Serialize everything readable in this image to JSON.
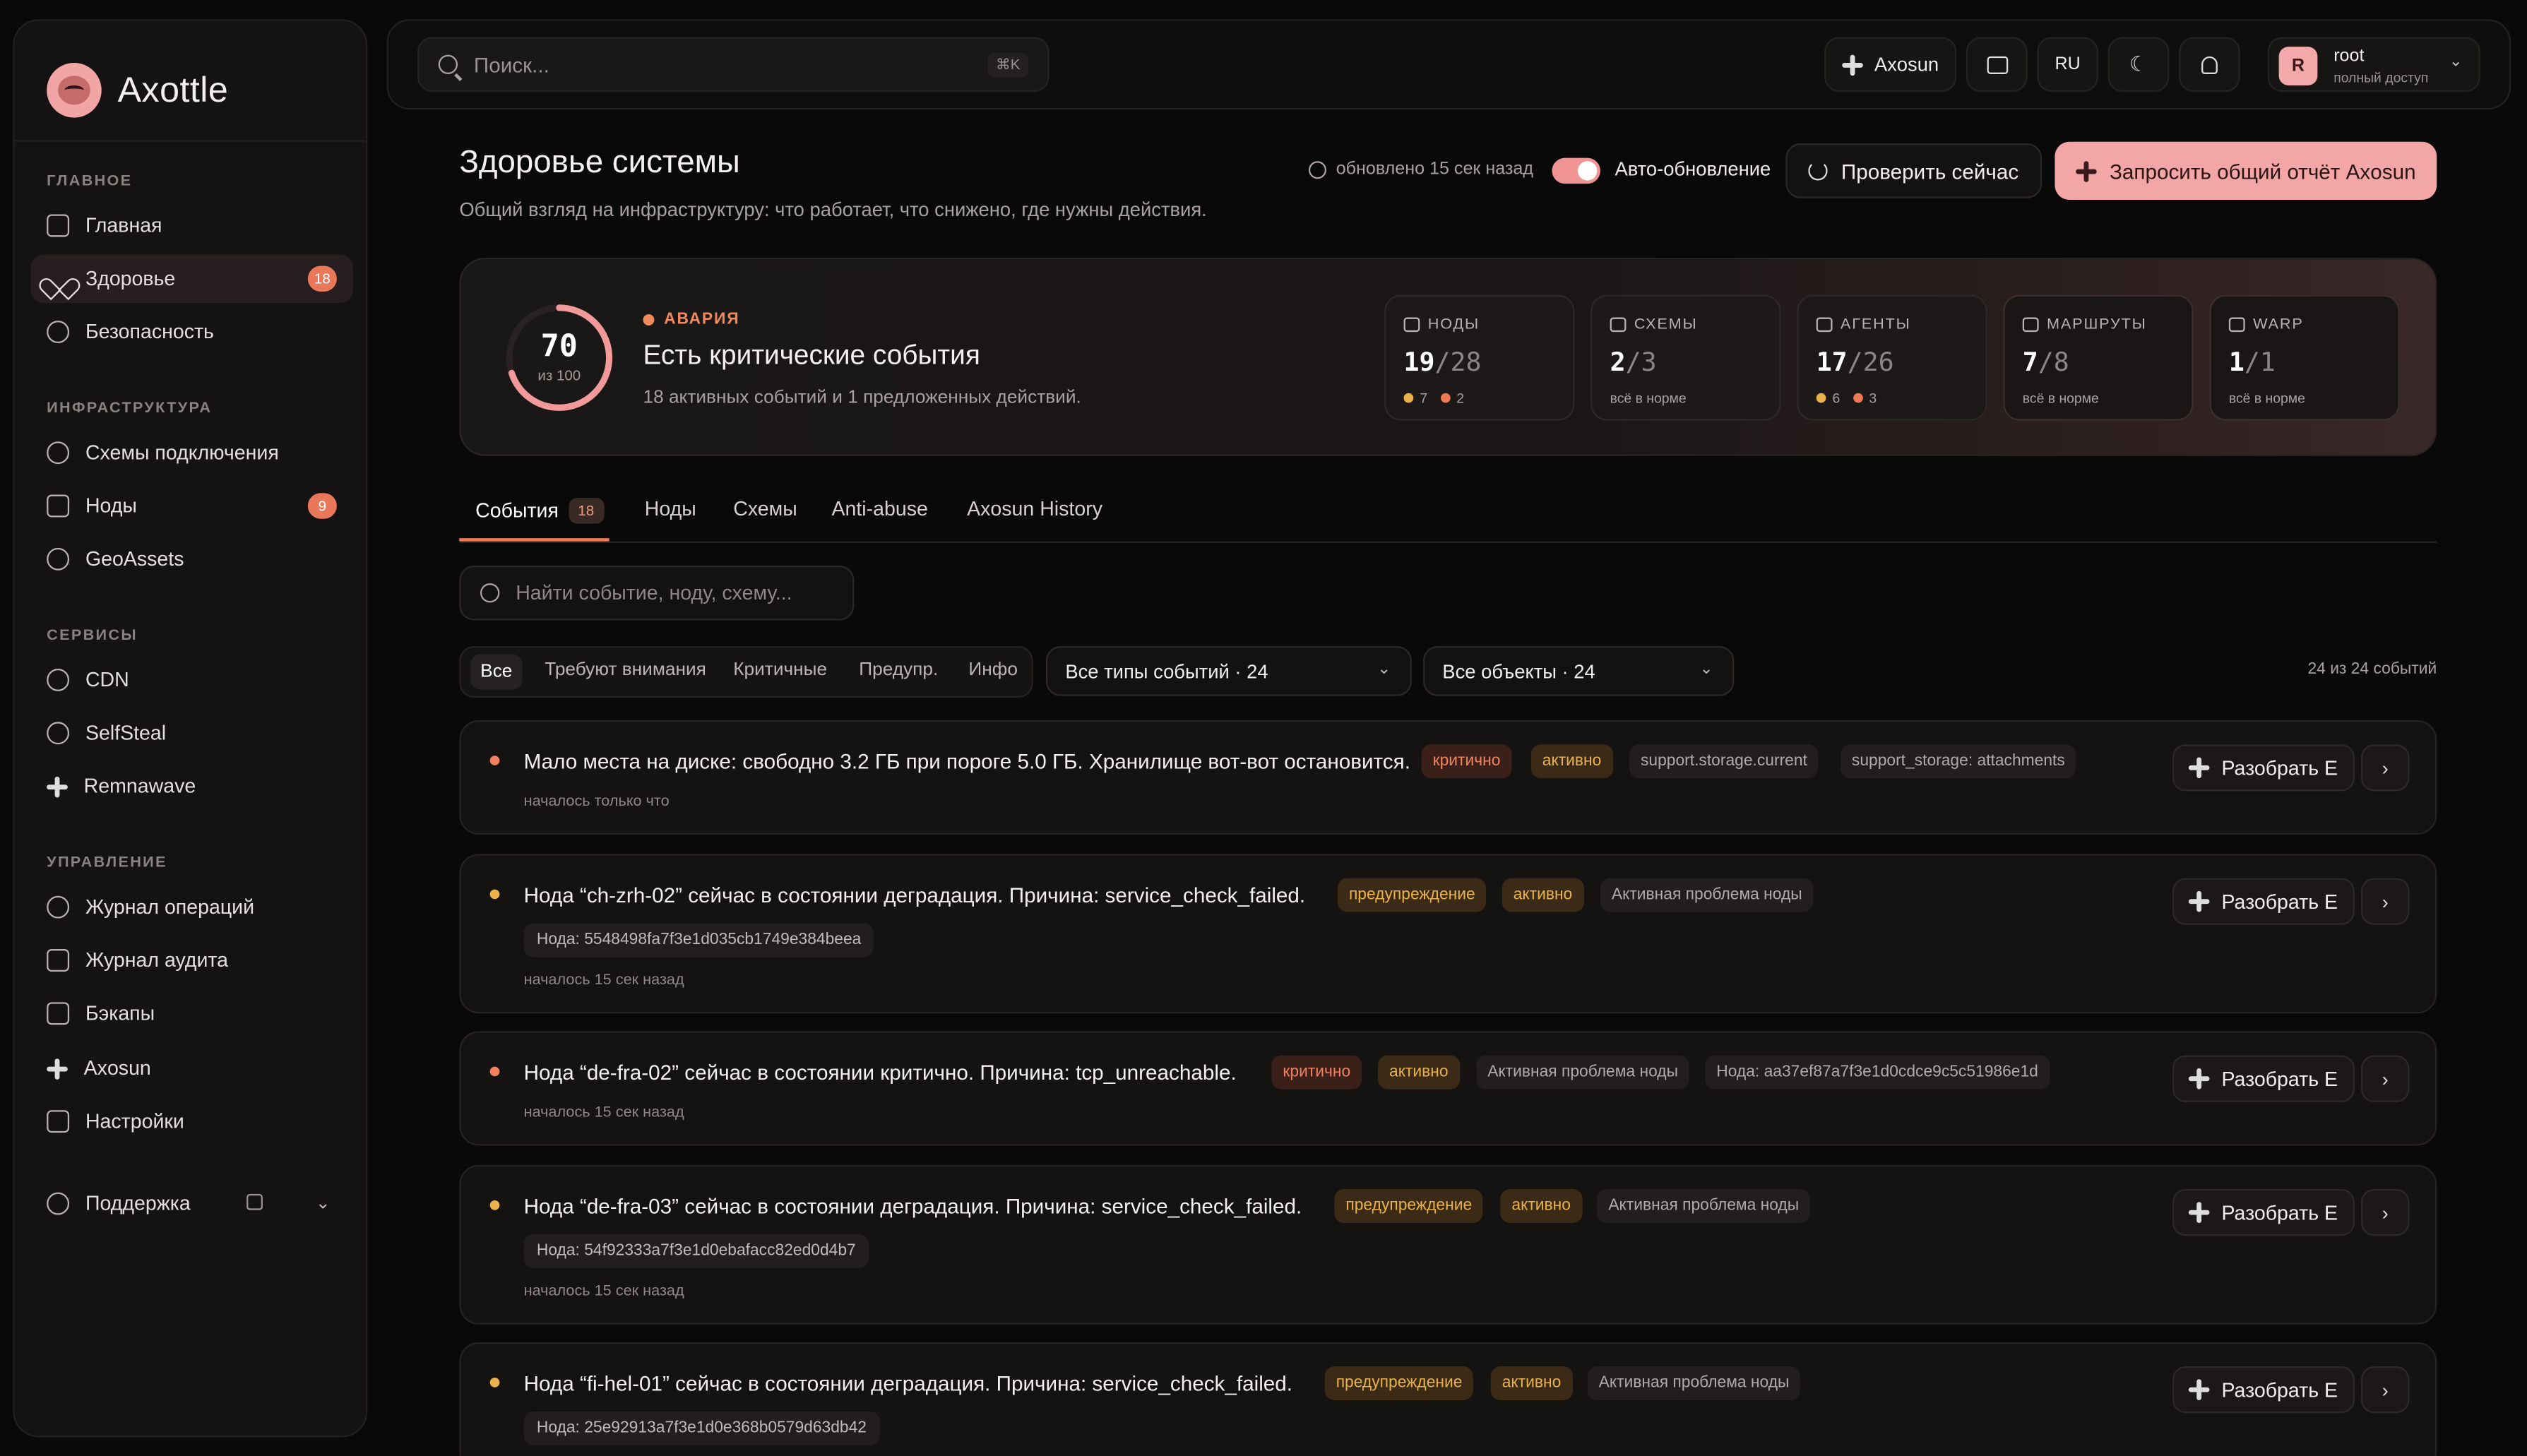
{
  "app": {
    "name": "Axottle"
  },
  "sidebar": {
    "sections": [
      {
        "title": "ГЛАВНОЕ"
      },
      {
        "title": "ИНФРАСТРУКТУРА"
      },
      {
        "title": "СЕРВИСЫ"
      },
      {
        "title": "УПРАВЛЕНИЕ"
      }
    ],
    "items": [
      {
        "label": "Главная",
        "icon": "dashboard-icon"
      },
      {
        "label": "Здоровье",
        "icon": "heart-pulse-icon",
        "badge": "18",
        "active": true
      },
      {
        "label": "Безопасность",
        "icon": "shield-icon"
      },
      {
        "label": "Схемы подключения",
        "icon": "network-icon"
      },
      {
        "label": "Ноды",
        "icon": "server-icon",
        "badge": "9"
      },
      {
        "label": "GeoAssets",
        "icon": "globe-icon"
      },
      {
        "label": "CDN",
        "icon": "cloud-icon"
      },
      {
        "label": "SelfSteal",
        "icon": "shield-check-icon"
      },
      {
        "label": "Remnawave",
        "icon": "sparkle-icon"
      },
      {
        "label": "Журнал операций",
        "icon": "history-icon"
      },
      {
        "label": "Журнал аудита",
        "icon": "audit-icon"
      },
      {
        "label": "Бэкапы",
        "icon": "archive-icon"
      },
      {
        "label": "Axosun",
        "icon": "sparkle-icon"
      },
      {
        "label": "Настройки",
        "icon": "sliders-icon"
      }
    ],
    "support": {
      "label": "Поддержка",
      "icon": "headset-icon"
    }
  },
  "topbar": {
    "search_placeholder": "Поиск...",
    "search_shortcut": "⌘K",
    "axosun_label": "Axosun",
    "lang": "RU",
    "user": {
      "initial": "R",
      "name": "root",
      "role": "полный доступ"
    }
  },
  "header": {
    "title": "Здоровье системы",
    "subtitle": "Общий взгляд на инфраструктуру: что работает, что снижено, где нужны действия.",
    "updated": "обновлено 15 сек назад",
    "auto_refresh_label": "Авто-обновление",
    "auto_refresh_on": true,
    "check_now": "Проверить сейчас",
    "report": "Запросить общий отчёт Axosun"
  },
  "status": {
    "score": "70",
    "score_of": "из 100",
    "score_fraction": 0.7,
    "level": "АВАРИЯ",
    "title": "Есть критические события",
    "subtitle": "18 активных событий и 1 предложенных действий.",
    "cards": [
      {
        "label": "НОДЫ",
        "value": "19",
        "total": "/28",
        "warn": "7",
        "crit": "2"
      },
      {
        "label": "СХЕМЫ",
        "value": "2",
        "total": "/3",
        "foot": "всё в норме"
      },
      {
        "label": "АГЕНТЫ",
        "value": "17",
        "total": "/26",
        "warn": "6",
        "crit": "3"
      },
      {
        "label": "МАРШРУТЫ",
        "value": "7",
        "total": "/8",
        "foot": "всё в норме"
      },
      {
        "label": "WARP",
        "value": "1",
        "total": "/1",
        "foot": "всё в норме"
      }
    ]
  },
  "tabs": [
    {
      "label": "События",
      "count": "18"
    },
    {
      "label": "Ноды"
    },
    {
      "label": "Схемы"
    },
    {
      "label": "Anti-abuse"
    },
    {
      "label": "Axosun History"
    }
  ],
  "event_search_placeholder": "Найти событие, ноду, схему...",
  "filters": [
    "Все",
    "Требуют внимания",
    "Критичные",
    "Предупр.",
    "Инфо"
  ],
  "selects": {
    "types": "Все типы событий · 24",
    "objects": "Все объекты · 24"
  },
  "count_label": "24 из 24 событий",
  "events": [
    {
      "title": "Мало места на диске: свободно 3.2 ГБ при пороге 5.0 ГБ. Хранилище вот-вот остановится.",
      "severity": "критично",
      "state": "активно",
      "tags": [
        "support.storage.current",
        "support_storage: attachments"
      ],
      "since": "началось только что",
      "action": "Разобрать E"
    },
    {
      "title": "Нода “ch-zrh-02” сейчас в состоянии деградация. Причина: service_check_failed.",
      "severity": "предупреждение",
      "state": "активно",
      "tags": [
        "Активная проблема ноды"
      ],
      "node": "Нода: 5548498fa7f3e1d035cb1749e384beea",
      "since": "началось 15 сек назад",
      "action": "Разобрать E"
    },
    {
      "title": "Нода “de-fra-02” сейчас в состоянии критично. Причина: tcp_unreachable.",
      "severity": "критично",
      "state": "активно",
      "tags": [
        "Активная проблема ноды",
        "Нода: aa37ef87a7f3e1d0cdce9c5c51986e1d"
      ],
      "since": "началось 15 сек назад",
      "action": "Разобрать E"
    },
    {
      "title": "Нода “de-fra-03” сейчас в состоянии деградация. Причина: service_check_failed.",
      "severity": "предупреждение",
      "state": "активно",
      "tags": [
        "Активная проблема ноды"
      ],
      "node": "Нода: 54f92333a7f3e1d0ebafacc82ed0d4b7",
      "since": "началось 15 сек назад",
      "action": "Разобрать E"
    },
    {
      "title": "Нода “fi-hel-01” сейчас в состоянии деградация. Причина: service_check_failed.",
      "severity": "предупреждение",
      "state": "активно",
      "tags": [
        "Активная проблема ноды"
      ],
      "node": "Нода: 25e92913a7f3e1d0e368b0579d63db42",
      "action": "Разобрать E"
    }
  ],
  "colors": {
    "accent": "#f3a6a6",
    "critical": "#f0825f",
    "warning": "#e9b24c",
    "background": "#0a0909"
  }
}
